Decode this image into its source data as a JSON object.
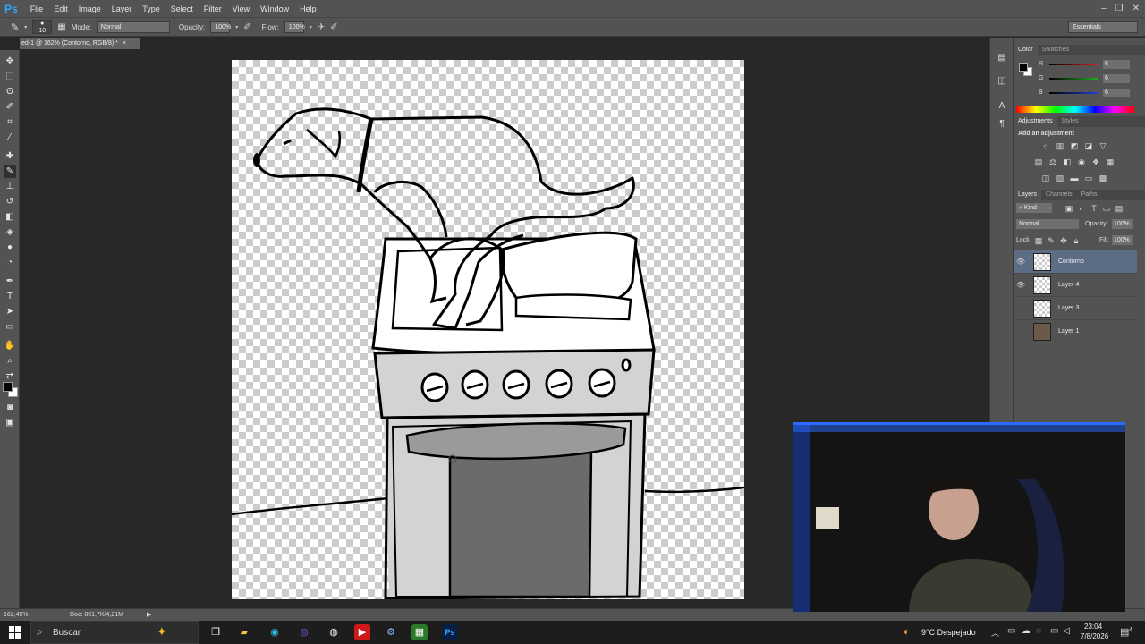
{
  "app": {
    "logo": "Ps",
    "menus": [
      "File",
      "Edit",
      "Image",
      "Layer",
      "Type",
      "Select",
      "Filter",
      "View",
      "Window",
      "Help"
    ],
    "window_controls": [
      "–",
      "❐",
      "✕"
    ]
  },
  "options_bar": {
    "brush_size": "10",
    "mode_label": "Mode:",
    "mode_value": "Normal",
    "opacity_label": "Opacity:",
    "opacity_value": "100%",
    "flow_label": "Flow:",
    "flow_value": "100%",
    "workspace": "Essentials"
  },
  "document": {
    "tab_title": "ed-1 @ 162% (Contorno, RGB/8) *",
    "tab_close": "×"
  },
  "status": {
    "zoom": "162,45%",
    "doc_info": "Doc: 861,7K/4,21M"
  },
  "color_panel": {
    "tabs": [
      "Color",
      "Swatches"
    ],
    "channels": [
      {
        "label": "R",
        "value": "6",
        "color": "#e02020"
      },
      {
        "label": "G",
        "value": "6",
        "color": "#20b020"
      },
      {
        "label": "B",
        "value": "6",
        "color": "#2040e0"
      }
    ]
  },
  "adjustments_panel": {
    "tabs": [
      "Adjustments",
      "Styles"
    ],
    "heading": "Add an adjustment"
  },
  "layers_panel": {
    "tabs": [
      "Layers",
      "Channels",
      "Paths"
    ],
    "filter_label": "Kind",
    "blend_mode": "Normal",
    "opacity_label": "Opacity:",
    "opacity_value": "100%",
    "lock_label": "Lock:",
    "fill_label": "Fill:",
    "fill_value": "100%",
    "layers": [
      {
        "name": "Contorno",
        "visible": true,
        "selected": true
      },
      {
        "name": "Layer 4",
        "visible": true,
        "selected": false
      },
      {
        "name": "Layer 3",
        "visible": false,
        "selected": false
      },
      {
        "name": "Layer 1",
        "visible": false,
        "selected": false
      }
    ]
  },
  "taskbar": {
    "search_placeholder": "Buscar",
    "weather": "9°C  Despejado",
    "time": "23:04",
    "date": "7/8/2026",
    "notification_count": "4"
  },
  "colors": {
    "accent": "#31a8ff",
    "panel_bg": "#535353",
    "workspace_bg": "#282828",
    "selected_layer": "#5d6d86"
  }
}
